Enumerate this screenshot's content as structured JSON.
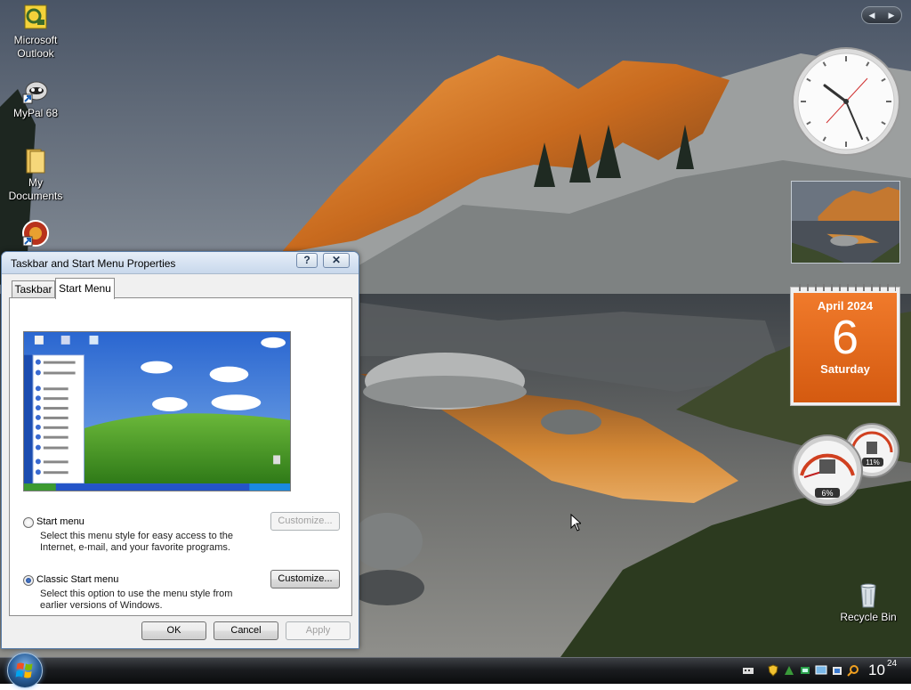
{
  "desktop": {
    "icons": [
      {
        "label": "Microsoft\nOutlook",
        "name": "outlook"
      },
      {
        "label": "MyPal 68",
        "name": "mypal"
      },
      {
        "label": "My\nDocuments",
        "name": "my-documents"
      },
      {
        "label": "",
        "name": "app"
      }
    ],
    "recycle_bin": "Recycle Bin"
  },
  "gadgets": {
    "calendar": {
      "month": "April 2024",
      "day": "6",
      "weekday": "Saturday"
    },
    "meters": {
      "cpu": "6%",
      "memory": "11%"
    }
  },
  "dialog": {
    "title": "Taskbar and Start Menu Properties",
    "help_glyph": "?",
    "close_glyph": "✕",
    "tabs": [
      "Taskbar",
      "Start Menu"
    ],
    "active_tab": "Start Menu",
    "options": [
      {
        "label": "Start menu",
        "checked": false,
        "description": "Select this menu style for easy access to the Internet, e-mail, and your favorite programs.",
        "customize": "Customize...",
        "customize_enabled": false
      },
      {
        "label": "Classic Start menu",
        "checked": true,
        "description": "Select this option to use the menu style from earlier versions of Windows.",
        "customize": "Customize...",
        "customize_enabled": true
      }
    ],
    "buttons": {
      "ok": "OK",
      "cancel": "Cancel",
      "apply": "Apply"
    }
  },
  "taskbar": {
    "clock_hour": "10",
    "clock_minute": "24"
  },
  "colors": {
    "calendar_orange": "#e46a1c",
    "taskbar": "#1b1d20",
    "dialog_frame": "#dfe8f3"
  }
}
